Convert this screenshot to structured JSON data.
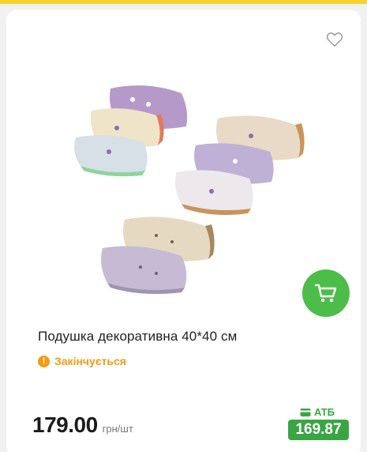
{
  "product": {
    "title": "Подушка декоративна 40*40 см",
    "status": "Закінчується",
    "price": "179.00",
    "unit": "грн/шт",
    "promo_label": "АТБ",
    "promo_price": "169.87"
  },
  "icons": {
    "favorite": "heart-outline-icon",
    "cart": "shopping-cart-icon",
    "status": "warning-icon",
    "promo": "card-icon"
  },
  "colors": {
    "accent_green": "#4dbd4a",
    "promo_green": "#3aa544",
    "warning_orange": "#f39b13",
    "top_strip": "#f6d22b"
  }
}
